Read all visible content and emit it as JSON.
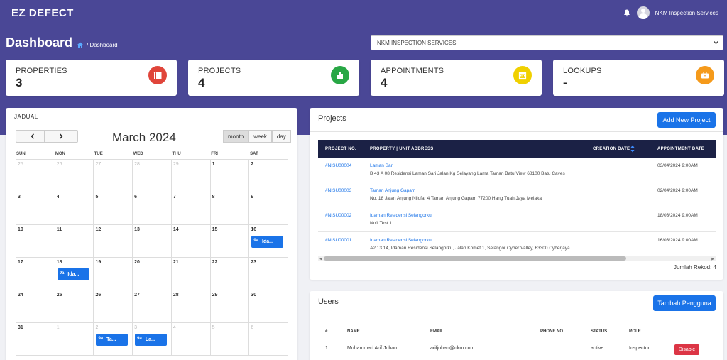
{
  "app": {
    "logo": "EZ DEFECT"
  },
  "header": {
    "user_name": "NKM Inspection Services"
  },
  "page": {
    "title": "Dashboard",
    "breadcrumb": "/ Dashboard"
  },
  "company_select": {
    "selected": "NKM INSPECTION SERVICES"
  },
  "stats": [
    {
      "label": "PROPERTIES",
      "value": "3",
      "color": "#e0453a",
      "icon": "building-icon"
    },
    {
      "label": "PROJECTS",
      "value": "4",
      "color": "#28a745",
      "icon": "bar-chart-icon"
    },
    {
      "label": "APPOINTMENTS",
      "value": "4",
      "color": "#f0d000",
      "icon": "calendar-icon"
    },
    {
      "label": "LOOKUPS",
      "value": "-",
      "color": "#f59a1b",
      "icon": "briefcase-icon"
    }
  ],
  "calendar": {
    "title": "JADUAL",
    "month": "March 2024",
    "views": [
      "month",
      "week",
      "day"
    ],
    "active_view": "month",
    "dow": [
      "SUN",
      "MON",
      "TUE",
      "WED",
      "THU",
      "FRI",
      "SAT"
    ],
    "weeks": [
      [
        {
          "d": "25",
          "o": true
        },
        {
          "d": "26",
          "o": true
        },
        {
          "d": "27",
          "o": true
        },
        {
          "d": "28",
          "o": true
        },
        {
          "d": "29",
          "o": true
        },
        {
          "d": "1"
        },
        {
          "d": "2"
        }
      ],
      [
        {
          "d": "3"
        },
        {
          "d": "4"
        },
        {
          "d": "5"
        },
        {
          "d": "6"
        },
        {
          "d": "7"
        },
        {
          "d": "8"
        },
        {
          "d": "9"
        }
      ],
      [
        {
          "d": "10"
        },
        {
          "d": "11"
        },
        {
          "d": "12"
        },
        {
          "d": "13"
        },
        {
          "d": "14"
        },
        {
          "d": "15"
        },
        {
          "d": "16",
          "ev": {
            "time": "9a",
            "title": "Ida..."
          }
        }
      ],
      [
        {
          "d": "17"
        },
        {
          "d": "18",
          "ev": {
            "time": "9a",
            "title": "Ida..."
          }
        },
        {
          "d": "19"
        },
        {
          "d": "20"
        },
        {
          "d": "21"
        },
        {
          "d": "22"
        },
        {
          "d": "23"
        }
      ],
      [
        {
          "d": "24"
        },
        {
          "d": "25"
        },
        {
          "d": "26"
        },
        {
          "d": "27"
        },
        {
          "d": "28"
        },
        {
          "d": "29"
        },
        {
          "d": "30"
        }
      ],
      [
        {
          "d": "31"
        },
        {
          "d": "1",
          "o": true
        },
        {
          "d": "2",
          "o": true,
          "ev": {
            "time": "9a",
            "title": "Ta..."
          }
        },
        {
          "d": "3",
          "o": true,
          "ev": {
            "time": "9a",
            "title": "La..."
          }
        },
        {
          "d": "4",
          "o": true
        },
        {
          "d": "5",
          "o": true
        },
        {
          "d": "6",
          "o": true
        }
      ]
    ]
  },
  "projects": {
    "title": "Projects",
    "add_label": "Add New Project",
    "columns": [
      "PROJECT NO.",
      "PROPERTY | UNIT ADDRESS",
      "CREATION DATE",
      "APPOINTMENT DATE"
    ],
    "rows": [
      {
        "no": "#NISU00004",
        "property": "Laman Sari",
        "address": "B 43 A 08 Residensi Laman Sari Jalan Kg Selayang Lama Taman Batu View 68100 Batu Caves",
        "appointment": "03/04/2024 9:00AM"
      },
      {
        "no": "#NISU00003",
        "property": "Taman Anjung Gapam",
        "address": "No. 18 Jalan Anjung Nilofar 4 Taman Anjung Gapam 77200 Hang Tuah Jaya Melaka",
        "appointment": "02/04/2024 9:00AM"
      },
      {
        "no": "#NISU00002",
        "property": "Idaman Residensi Selangorku",
        "address": "No1 Test 1",
        "appointment": "18/03/2024 9:00AM"
      },
      {
        "no": "#NISU00001",
        "property": "Idaman Residensi Selangorku",
        "address": "A2 13 14, Idaman Residensi Selangorku, Jalan Komet 1, Selangor Cyber Valley, 63300 Cyberjaya",
        "appointment": "16/03/2024 9:00AM"
      }
    ],
    "record_count": "Jumlah Rekod: 4"
  },
  "users": {
    "title": "Users",
    "add_label": "Tambah Pengguna",
    "columns": [
      "#",
      "NAME",
      "EMAIL",
      "PHONE NO",
      "STATUS",
      "ROLE"
    ],
    "rows": [
      {
        "no": "1",
        "name": "Muhammad Arif Johan",
        "email": "arifjohan@nkm.com",
        "phone": "",
        "status": "active",
        "role": "Inspector",
        "action": "Disable"
      }
    ]
  }
}
